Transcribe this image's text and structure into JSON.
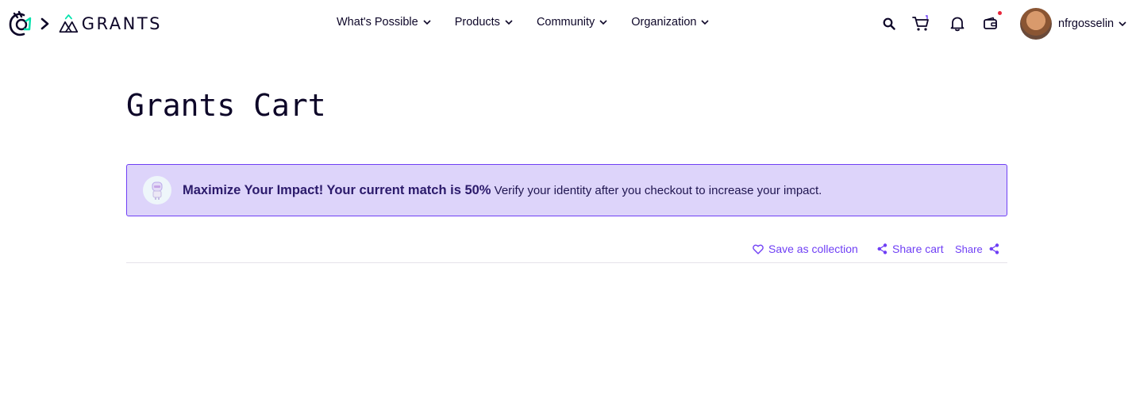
{
  "header": {
    "brand_word": "GRANTS",
    "nav": [
      {
        "label": "What's Possible"
      },
      {
        "label": "Products"
      },
      {
        "label": "Community"
      },
      {
        "label": "Organization"
      }
    ],
    "icons": [
      "search-icon",
      "cart-icon",
      "bell-icon",
      "wallet-icon"
    ],
    "profile_name": "nfrgosselin"
  },
  "main": {
    "title": "Grants Cart",
    "banner": {
      "strong": "Maximize Your Impact! Your current match is 50%",
      "text": " Verify your identity after you checkout to increase your impact."
    },
    "actions": {
      "save_collection": "Save as collection",
      "share_cart": "Share cart",
      "share": "Share"
    }
  },
  "colors": {
    "accent": "#6f3ff5",
    "banner_bg": "#ddd4fa",
    "text": "#0d0628",
    "notification_dot": "#e8263b"
  }
}
